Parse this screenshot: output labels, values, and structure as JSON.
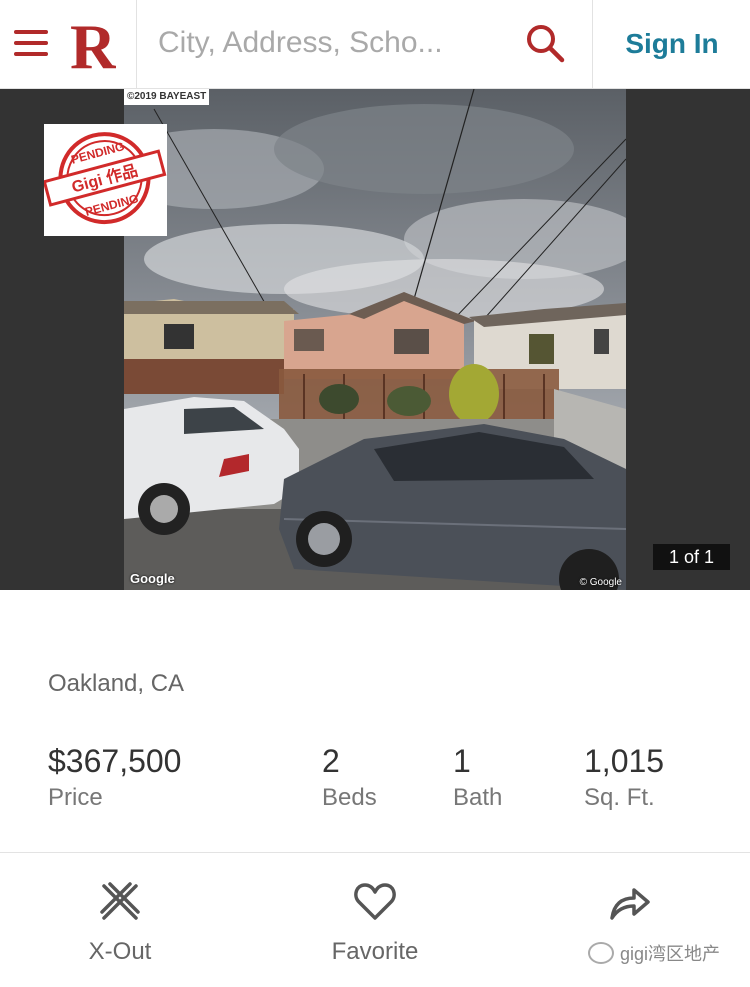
{
  "header": {
    "logo_letter": "R",
    "search_placeholder": "City, Address, Scho...",
    "sign_in_label": "Sign In"
  },
  "photo": {
    "counter": "1 of 1",
    "stamp_top": "PENDING",
    "stamp_middle": "Gigi 作品",
    "stamp_bottom": "PENDING",
    "watermark_top": "©2019 BAYEAST",
    "google_left": "Google",
    "google_right": "© Google"
  },
  "listing": {
    "location": "Oakland, CA",
    "stats": [
      {
        "value": "$367,500",
        "label": "Price"
      },
      {
        "value": "2",
        "label": "Beds"
      },
      {
        "value": "1",
        "label": "Bath"
      },
      {
        "value": "1,015",
        "label": "Sq. Ft."
      }
    ]
  },
  "actions": [
    {
      "label": "X-Out",
      "icon": "x-out-icon"
    },
    {
      "label": "Favorite",
      "icon": "heart-icon"
    },
    {
      "label": "",
      "icon": "share-arrow-icon"
    }
  ],
  "wechat_watermark": "gigi湾区地产",
  "colors": {
    "brand_red": "#b12a2a",
    "sign_in_teal": "#1d7c99",
    "photo_background": "#333333"
  }
}
